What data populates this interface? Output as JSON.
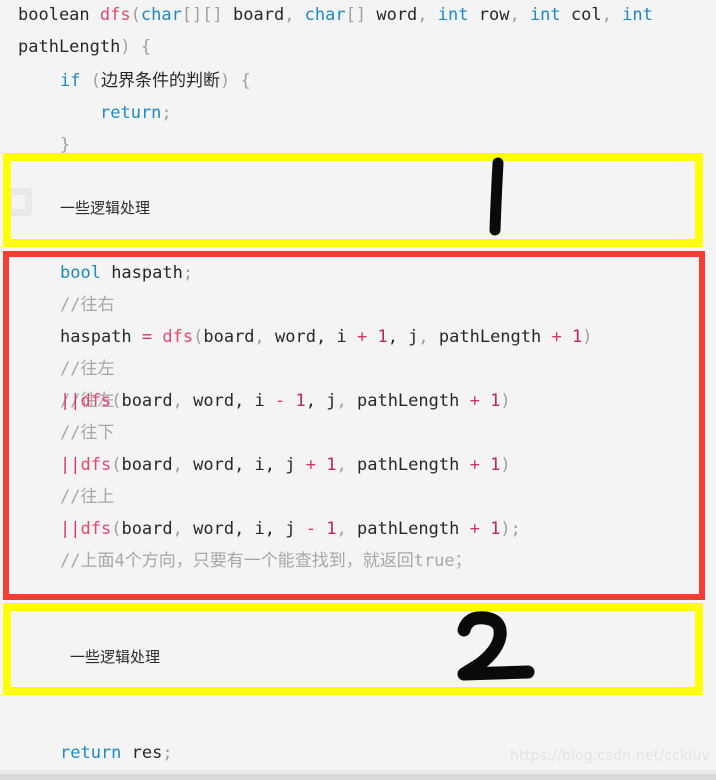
{
  "page": {
    "background_color": "#f4f4f4",
    "watermark": "https://blog.csdn.net/cckluv"
  },
  "colors": {
    "keyword": "#1a8bc4",
    "function": "#e8466e",
    "punctuation": "#a0a0a0",
    "number": "#c7254e",
    "operator": "#d6336c",
    "comment": "#a7a7a7",
    "plain": "#24292e",
    "highlight_yellow": "#ffff00",
    "highlight_red": "#fc3b32"
  },
  "code": {
    "line1": {
      "a": "boolean ",
      "b": "dfs",
      "c": "(",
      "d": "char",
      "e": "[][] ",
      "f": "board",
      "g": ", ",
      "h": "char",
      "i": "[] ",
      "j": "word",
      "k": ", ",
      "l": "int",
      "m": " row",
      "n": ", ",
      "o": "int",
      "p": " col",
      "q": ", ",
      "r": "int"
    },
    "line2": {
      "a": "pathLength",
      "b": ") {"
    },
    "line3": {
      "a": "if",
      "b": " (",
      "c": "边界条件的判断",
      "d": ") {"
    },
    "line4": {
      "a": "return",
      "b": ";"
    },
    "line5": {
      "a": "}"
    },
    "line6": {
      "a": "bool",
      "b": " haspath",
      "c": ";"
    },
    "line7": {
      "a": "//往右"
    },
    "line8": {
      "a": "haspath ",
      "b": "=",
      "c": " ",
      "d": "dfs",
      "e": "(",
      "f": "board",
      "g": ", ",
      "h": "word",
      "i": ", i ",
      "j": "+",
      "k": " ",
      "l": "1",
      "m": ", j",
      "n": ", ",
      "o": "pathLength ",
      "p": "+",
      "q": " ",
      "r": "1",
      "s": ")"
    },
    "line9": {
      "a": "//往左"
    },
    "line10": {
      "a": "||",
      "b": "dfs",
      "c": "(",
      "d": "board",
      "e": ", ",
      "f": "word",
      "g": ", i ",
      "h": "-",
      "i": " ",
      "j": "1",
      "k": ", j",
      "l": ", ",
      "m": "pathLength ",
      "n": "+",
      "o": " ",
      "p": "1",
      "q": ")"
    },
    "line11": {
      "a": "//往下"
    },
    "line12": {
      "a": "||",
      "b": "dfs",
      "c": "(",
      "d": "board",
      "e": ", ",
      "f": "word",
      "g": ", i",
      "h": ", j ",
      "i": "+",
      "j": " ",
      "k": "1",
      "l": ", ",
      "m": "pathLength ",
      "n": "+",
      "o": " ",
      "p": "1",
      "q": ")"
    },
    "line13": {
      "a": "//往上"
    },
    "line14": {
      "a": "||",
      "b": "dfs",
      "c": "(",
      "d": "board",
      "e": ", ",
      "f": "word",
      "g": ", i",
      "h": ", j ",
      "i": "-",
      "j": " ",
      "k": "1",
      "l": ", ",
      "m": "pathLength ",
      "n": "+",
      "o": " ",
      "p": "1",
      "q": ");"
    },
    "line15": {
      "a": "//上面4个方向，只要有一个能查找到，就返回true；"
    },
    "line16": {
      "a": "return",
      "b": " res",
      "c": ";"
    }
  },
  "annotations": {
    "box1": {
      "label": "一些逻辑处理",
      "mark": "1"
    },
    "box2": {
      "label": "一些逻辑处理",
      "mark": "2"
    }
  }
}
